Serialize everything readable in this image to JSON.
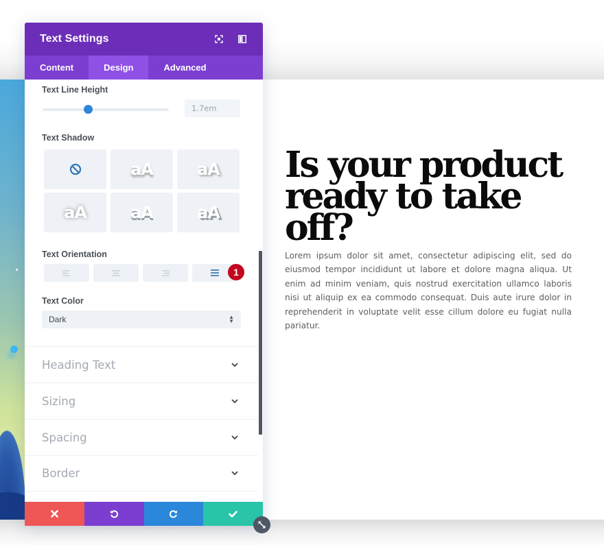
{
  "modal": {
    "title": "Text Settings",
    "header_icons": [
      "fullscreen-icon",
      "split-view-icon"
    ],
    "tabs": [
      {
        "label": "Content",
        "active": false
      },
      {
        "label": "Design",
        "active": true
      },
      {
        "label": "Advanced",
        "active": false
      }
    ],
    "line_height": {
      "label": "Text Line Height",
      "value": "1.7em",
      "slider_fraction": 0.36
    },
    "text_shadow": {
      "label": "Text Shadow",
      "options": [
        {
          "type": "none",
          "icon": "none-icon"
        },
        {
          "type": "preset",
          "sample": "aA"
        },
        {
          "type": "preset",
          "sample": "aA"
        },
        {
          "type": "preset",
          "sample": "aA"
        },
        {
          "type": "preset",
          "sample": "aA"
        },
        {
          "type": "preset",
          "sample": "aA"
        }
      ]
    },
    "text_orientation": {
      "label": "Text Orientation",
      "options": [
        "left",
        "center",
        "right",
        "justified"
      ],
      "selected": "justified",
      "badge": "1"
    },
    "text_color": {
      "label": "Text Color",
      "selected": "Dark"
    },
    "sections": [
      {
        "label": "Heading Text"
      },
      {
        "label": "Sizing"
      },
      {
        "label": "Spacing"
      },
      {
        "label": "Border"
      }
    ],
    "footer_actions": [
      {
        "name": "cancel",
        "icon": "close-icon"
      },
      {
        "name": "undo",
        "icon": "undo-icon"
      },
      {
        "name": "redo",
        "icon": "redo-icon"
      },
      {
        "name": "save",
        "icon": "check-icon"
      }
    ]
  },
  "page": {
    "headline": "Is your product ready to take off?",
    "body": "Lorem ipsum dolor sit amet, consectetur adipiscing elit, sed do eiusmod tempor incididunt ut labore et dolore magna aliqua. Ut enim ad minim veniam, quis nostrud exercitation ullamco laboris nisi ut aliquip ex ea commodo consequat. Duis aute irure dolor in reprehenderit in voluptate velit esse cillum dolore eu fugiat nulla pariatur."
  },
  "colors": {
    "header": "#6c2eb9",
    "tabs": "#7b3ed0",
    "tab_active": "#8f50e6",
    "accent_blue": "#2e86d9",
    "badge": "#c3071e",
    "cancel": "#ef5656",
    "undo": "#7b3ed0",
    "redo": "#2b87da",
    "save": "#29c4a9"
  }
}
